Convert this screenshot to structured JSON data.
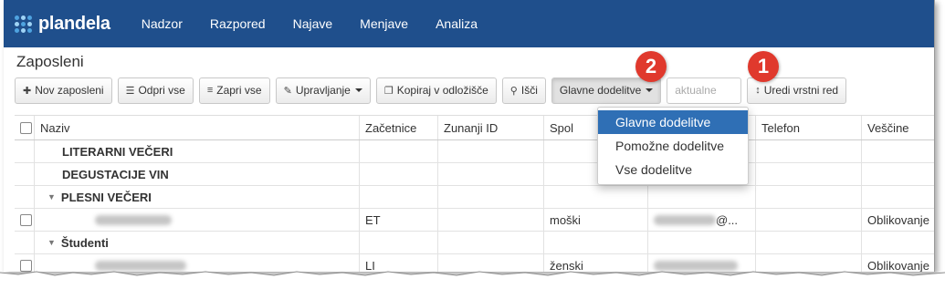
{
  "brand": {
    "text": "plandela",
    "dot_colors": [
      "#4fa3e0",
      "#9fd3f5",
      "#4fa3e0",
      "#9fd3f5",
      "#4fa3e0",
      "#9fd3f5",
      "#4fa3e0",
      "#9fd3f5",
      "#4fa3e0"
    ]
  },
  "nav": {
    "items": [
      "Nadzor",
      "Razpored",
      "Najave",
      "Menjave",
      "Analiza"
    ]
  },
  "page": {
    "title": "Zaposleni"
  },
  "toolbar": {
    "new_employee": "Nov zaposleni",
    "open_all": "Odpri vse",
    "close_all": "Zapri vse",
    "manage": "Upravljanje",
    "copy_clipboard": "Kopiraj v odložišče",
    "search": "Išči",
    "assignments": "Glavne dodelitve",
    "filter_placeholder": "aktualne",
    "edit_order": "Uredi vrstni red"
  },
  "badges": {
    "one": "1",
    "two": "2"
  },
  "dropdown": {
    "items": [
      "Glavne dodelitve",
      "Pomožne dodelitve",
      "Vse dodelitve"
    ],
    "selected_index": 0
  },
  "table": {
    "headers": [
      "Naziv",
      "Začetnice",
      "Zunanji ID",
      "Spol",
      "",
      "Telefon",
      "Veščine"
    ],
    "rows": [
      {
        "type": "group",
        "name": "LITERARNI VEČERI"
      },
      {
        "type": "group",
        "name": "DEGUSTACIJE VIN"
      },
      {
        "type": "group-expanded",
        "name": "PLESNI VEČERI"
      },
      {
        "type": "person",
        "initials": "ET",
        "gender": "moški",
        "email": "@...",
        "skills": "Oblikovanje"
      },
      {
        "type": "group-expanded",
        "name": "Študenti"
      },
      {
        "type": "person",
        "initials": "LI",
        "gender": "ženski",
        "email": "",
        "skills": "Oblikovanje"
      }
    ]
  },
  "colors": {
    "navbar": "#1f4f8c",
    "badge": "#e0392d",
    "selected": "#2f6fb5"
  }
}
